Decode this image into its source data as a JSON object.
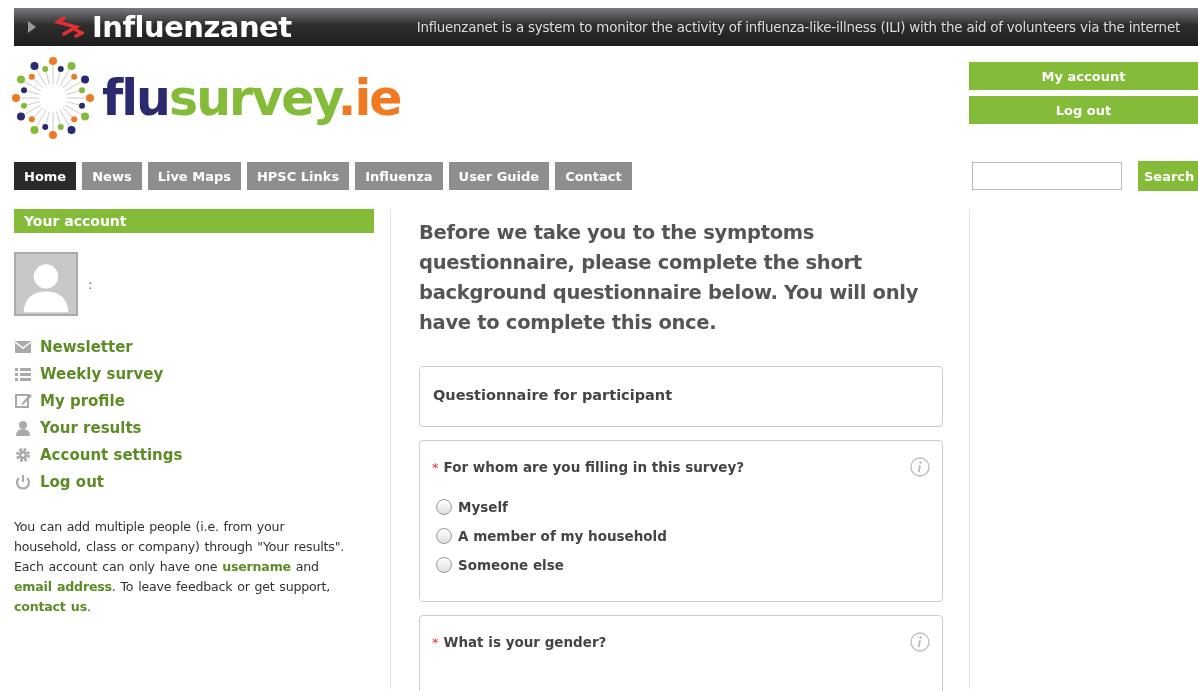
{
  "top_bar": {
    "brand": "Influenzanet",
    "tagline": "Influenzanet is a system to monitor the activity of influenza-like-illness (ILI) with the aid of volunteers via the internet"
  },
  "logo": {
    "parts": [
      {
        "text": "flu",
        "color": "#2b2a6e"
      },
      {
        "text": "survey",
        "color": "#84bc3a"
      },
      {
        "text": ".ie",
        "color": "#f07a22"
      }
    ]
  },
  "account_buttons": [
    "My account",
    "Log out"
  ],
  "nav": [
    {
      "label": "Home",
      "selected": true
    },
    {
      "label": "News",
      "selected": false
    },
    {
      "label": "Live Maps",
      "selected": false
    },
    {
      "label": "HPSC Links",
      "selected": false
    },
    {
      "label": "Influenza",
      "selected": false
    },
    {
      "label": "User Guide",
      "selected": false
    },
    {
      "label": "Contact",
      "selected": false
    }
  ],
  "search": {
    "button": "Search"
  },
  "sidebar": {
    "title": "Your account",
    "user_label": ":",
    "links": [
      {
        "label": "Newsletter",
        "kind": "mail"
      },
      {
        "label": "Weekly survey",
        "kind": "list"
      },
      {
        "label": "My profile",
        "kind": "edit"
      },
      {
        "label": "Your results",
        "kind": "person"
      },
      {
        "label": "Account settings",
        "kind": "gear"
      },
      {
        "label": "Log out",
        "kind": "power"
      }
    ],
    "help_text": [
      {
        "text": "You can add multiple people (i.e. from your household, class or company) through \"Your results\". Each account can only have one ",
        "kind": "text"
      },
      {
        "text": "username",
        "kind": "link"
      },
      {
        "text": " and ",
        "kind": "text"
      },
      {
        "text": "email address",
        "kind": "link"
      },
      {
        "text": ". To leave feedback or get support, ",
        "kind": "text"
      },
      {
        "text": "contact us",
        "kind": "link"
      },
      {
        "text": ".",
        "kind": "text"
      }
    ]
  },
  "main": {
    "intro": "Before we take you to the symptoms questionnaire, please complete the short background questionnaire below. You will only have to complete this once.",
    "questionnaire_title": "Questionnaire for participant",
    "questions": [
      {
        "marker": "*",
        "text": "For whom are you filling in this survey?",
        "options": [
          {
            "label": "Myself",
            "selected": false
          },
          {
            "label": "A member of my household",
            "selected": false
          },
          {
            "label": "Someone else",
            "selected": false
          }
        ]
      },
      {
        "marker": "*",
        "text": "What is your gender?"
      }
    ]
  }
}
